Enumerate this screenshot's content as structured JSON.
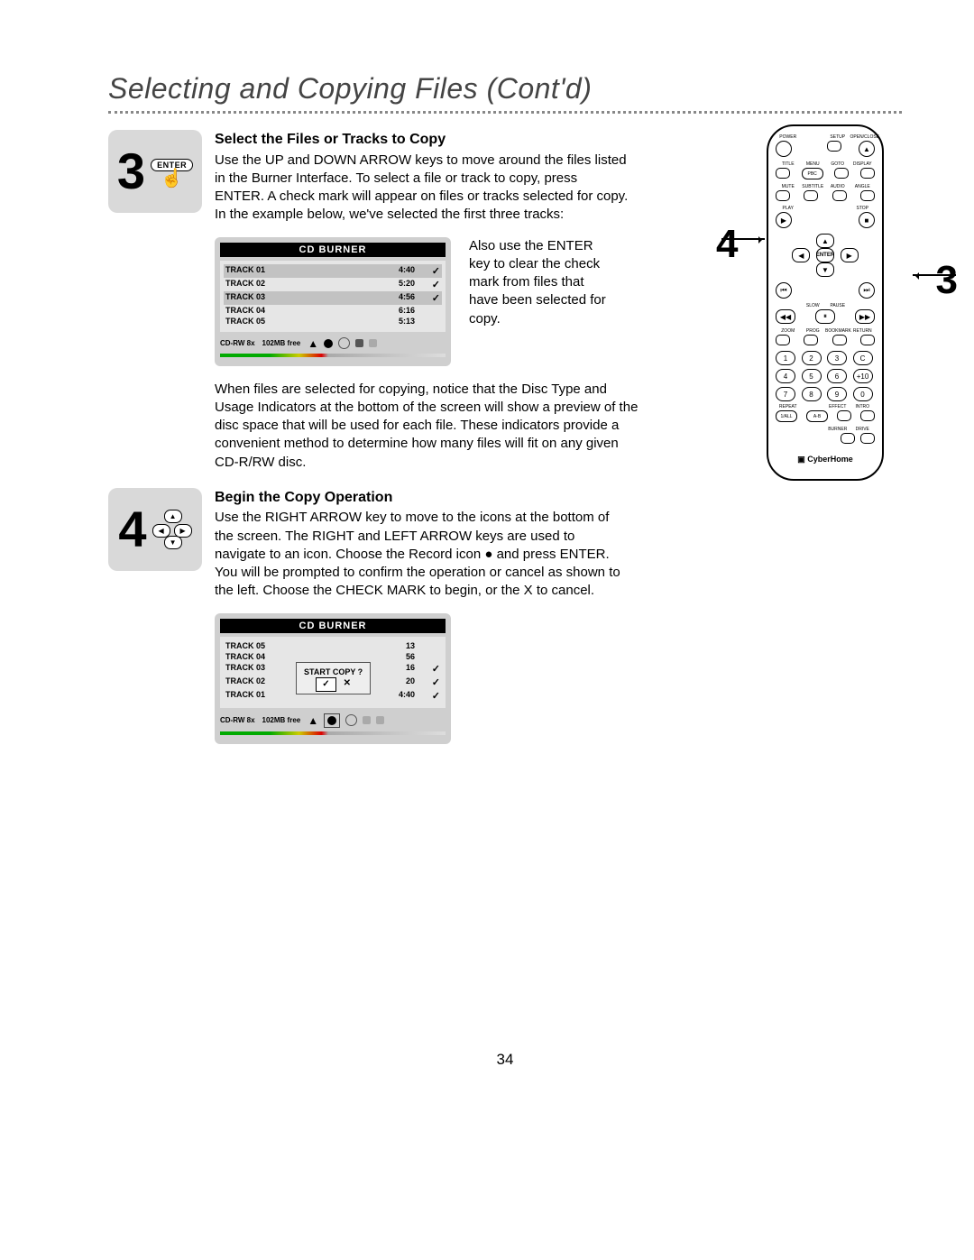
{
  "title": "Selecting and Copying Files (Cont'd)",
  "step3": {
    "num": "3",
    "enter_label": "ENTER",
    "heading": "Select the Files or Tracks to Copy",
    "body": "Use the UP and DOWN ARROW keys to move around the files listed in the Burner Interface. To select a file or track to copy, press ENTER. A check mark will appear on files or tracks selected for copy. In the example below, we've selected the first three tracks:"
  },
  "screen1": {
    "header": "CD BURNER",
    "tracks": [
      {
        "name": "TRACK 01",
        "time": "4:40",
        "checked": true,
        "sel": true
      },
      {
        "name": "TRACK 02",
        "time": "5:20",
        "checked": true,
        "sel": false
      },
      {
        "name": "TRACK 03",
        "time": "4:56",
        "checked": true,
        "sel": true
      },
      {
        "name": "TRACK 04",
        "time": "6:16",
        "checked": false,
        "sel": false
      },
      {
        "name": "TRACK 05",
        "time": "5:13",
        "checked": false,
        "sel": false
      }
    ],
    "status_disc": "CD-RW 8x",
    "status_free": "102MB free"
  },
  "sidenote": "Also use the ENTER key to clear the check mark from files that have been selected for copy.",
  "para2": "When files are selected for copying, notice that the Disc Type and Usage Indicators at the bottom of the screen will show a preview of the disc space that will be used for each file. These indicators provide a convenient method to determine how many files will fit on any given CD-R/RW disc.",
  "step4": {
    "num": "4",
    "heading": "Begin the Copy Operation",
    "body": "Use the RIGHT ARROW key to move to the icons at the bottom of the screen. The RIGHT and LEFT ARROW keys are used to navigate to an icon. Choose the Record icon ● and press ENTER. You will be prompted to confirm the operation or cancel as shown to the left. Choose the CHECK MARK to begin, or the X to cancel."
  },
  "screen2": {
    "header": "CD BURNER",
    "dialog": "START COPY ?",
    "dialog_ok": "✓",
    "dialog_cancel": "✕",
    "tracks": [
      {
        "name": "TRACK 01",
        "time": "4:40",
        "checked": true
      },
      {
        "name": "TRACK 02",
        "time": "20",
        "checked": true
      },
      {
        "name": "TRACK 03",
        "time": "16",
        "checked": true
      },
      {
        "name": "TRACK 04",
        "time": "56",
        "checked": false
      },
      {
        "name": "TRACK 05",
        "time": "13",
        "checked": false
      }
    ],
    "status_disc": "CD-RW 8x",
    "status_free": "102MB free"
  },
  "callout4": "4",
  "callout3": "3",
  "remote": {
    "row1_labels": [
      "POWER",
      "",
      "SETUP",
      "OPEN/CLOSE"
    ],
    "row2_labels": [
      "TITLE",
      "MENU",
      "GOTO",
      "DISPLAY"
    ],
    "row3_labels": [
      "MUTE",
      "SUBTITLE",
      "AUDIO",
      "ANGLE"
    ],
    "row4_labels": [
      "PLAY",
      "",
      "",
      "STOP"
    ],
    "row5_labels": [
      "",
      "SLOW",
      "PAUSE",
      ""
    ],
    "row6_labels": [
      "ZOOM",
      "PROG",
      "BOOKMARK",
      "RETURN"
    ],
    "row7_labels": [
      "REPEAT",
      "",
      "EFFECT",
      "INTRO"
    ],
    "row8_labels": [
      "1/ALL",
      "A-B",
      "",
      ""
    ],
    "row9_labels": [
      "",
      "",
      "BURNER",
      "DRIVE"
    ],
    "dpad": {
      "up": "▲",
      "down": "▼",
      "left": "◀",
      "right": "▶",
      "center": "ENTER"
    },
    "skip_prev": "⏮",
    "skip_next": "⏭",
    "rev": "◀◀",
    "pause": "⏸",
    "fwd": "▶▶",
    "nums": [
      "1",
      "2",
      "3",
      "C",
      "4",
      "5",
      "6",
      "+10",
      "7",
      "8",
      "9",
      "0"
    ],
    "brand": "CyberHome"
  },
  "page_number": "34"
}
